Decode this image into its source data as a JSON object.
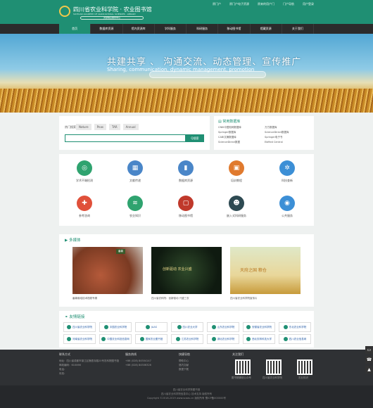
{
  "header": {
    "logo_cn": "四川省农业科学院 · 农业图书馆",
    "logo_en": "SICHUAN ACADEMY OF AGRICULTURAL SCIENCES · LIBRARY",
    "slogan": "文献信息服务中心",
    "links": [
      "原门户",
      "原门户电子资源",
      "原来的用户门",
      "门户导航",
      "用户登录"
    ]
  },
  "nav": [
    "首页",
    "数据库资源",
    "馆内资源库",
    "学科服务",
    "科研服务",
    "移动图书馆",
    "馆藏资源",
    "关于我们"
  ],
  "banner": {
    "search_placeholder": "",
    "title_cn": "共建共享 、 沟通交流、动态管理、宣传推广",
    "title_en": "Sharing, communication, dynamic management, promotion"
  },
  "search": {
    "label": "热门搜索：",
    "chips": [
      "Nature",
      "Pnas",
      "TAR",
      "Annual"
    ],
    "button": "Q搜索"
  },
  "databases": {
    "title": "常用数据库",
    "items": [
      "CNKI中国知网数据库",
      "万方数据库",
      "Springer数据库",
      "ScienceDirect数据库",
      "CABI文摘数据库",
      "Springer电子书",
      "ScienceDirect数据",
      "EbMed Central"
    ]
  },
  "services": [
    {
      "label": "学术不端检测",
      "icon": "target-icon",
      "color": "#2fa36f"
    },
    {
      "label": "文献传递",
      "icon": "book-stack-icon",
      "color": "#4a86c8"
    },
    {
      "label": "数据库资源",
      "icon": "database-icon",
      "color": "#4a86c8"
    },
    {
      "label": "培训教程",
      "icon": "chalkboard-icon",
      "color": "#e07a2e"
    },
    {
      "label": "科技查新",
      "icon": "gear-icon",
      "color": "#3c8fd6"
    },
    {
      "label": "参考咨询",
      "icon": "lifebuoy-icon",
      "color": "#e0503a"
    },
    {
      "label": "农业知识",
      "icon": "layers-icon",
      "color": "#2fa36f"
    },
    {
      "label": "移动图书馆",
      "icon": "book-open-icon",
      "color": "#c0392b"
    },
    {
      "label": "嵌入式科研服务",
      "icon": "user-icon",
      "color": "#2e4a52"
    },
    {
      "label": "公共服务",
      "icon": "broadcast-icon",
      "color": "#3c8fd6"
    }
  ],
  "media": {
    "title": "多媒体",
    "items": [
      {
        "caption": "番薯栽培技术视频专辑",
        "overlay": "番薯"
      },
      {
        "caption": "四川省农科院：创新驱动 兴盛三农",
        "overlay": "创新驱动 农业兴盛"
      },
      {
        "caption": "四川省农业科学院宣传片",
        "overlay": "天府之国 粮仓"
      }
    ]
  },
  "links": {
    "title": "友情链接",
    "items": [
      "四川省农业科学院",
      "中国农业科学院",
      "JAAS",
      "四川农业大学",
      "山东农业科学院",
      "安徽省农业科学院",
      "东北农业科学院",
      "河南省农业科学院",
      "中国农业科技信息网",
      "国家农业图书馆",
      "江苏农业科学院",
      "湖北农业科学院",
      "西北农林科技大学",
      "四川农业信息网"
    ]
  },
  "footer": {
    "contact_title": "联系方式",
    "contact": [
      "地址：四川省成都市锦江区静居寺路20号农科院图书馆",
      "邮政编码：610066",
      "电话：",
      "传真："
    ],
    "hotline_title": "服务热线",
    "hotline": [
      "+86 (028) 84504147",
      "+86 (028) 84506326"
    ],
    "quick_title": "快捷导航",
    "quick": [
      "帮助中心",
      "馆内文献",
      "数据下载"
    ],
    "follow_title": "关注我们",
    "qr_captions": [
      "图书馆微信公众号",
      "四川省农业科学院",
      "农业知识"
    ],
    "copyright": [
      "四川省农业科学院图书馆",
      "四川省农业科学院信息中心 技术支持 版权所有",
      "Copyright ©2018-2019 www.scaas.cn 版权所有 蜀ICP备000000号"
    ]
  },
  "side_icons": [
    "chat-icon",
    "phone-icon",
    "up-arrow-icon"
  ]
}
